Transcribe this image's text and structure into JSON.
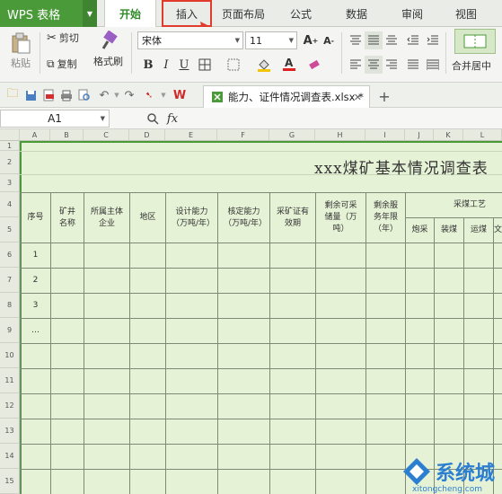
{
  "app": {
    "name": "WPS 表格"
  },
  "tabs": [
    "开始",
    "插入",
    "页面布局",
    "公式",
    "数据",
    "审阅",
    "视图"
  ],
  "ribbon": {
    "paste": "粘贴",
    "cut": "剪切",
    "copy": "复制",
    "format_painter": "格式刷",
    "font_name": "宋体",
    "font_size": "11",
    "merge": "合并居中"
  },
  "doc_tab": {
    "label": "能力、证件情况调查表.xlsx *"
  },
  "formula_bar": {
    "name_box": "A1",
    "fx": "fx"
  },
  "sheet": {
    "columns": [
      "A",
      "B",
      "C",
      "D",
      "E",
      "F",
      "G",
      "H",
      "I",
      "J",
      "K",
      "L"
    ],
    "rows": [
      "1",
      "2",
      "3",
      "4",
      "5",
      "6",
      "7",
      "8",
      "9",
      "10",
      "11",
      "12",
      "13",
      "14",
      "15"
    ],
    "title": "xxx煤矿基本情况调查表",
    "headers": {
      "seq": "序号",
      "mine_name": "矿井名称",
      "owner": "所属主体企业",
      "region": "地区",
      "design_capacity": "设计能力（万吨/年）",
      "approved_capacity": "核定能力（万吨/年）",
      "mining_license": "采矿证有效期",
      "reserves": "剩余可采储量（万吨）",
      "service_years": "剩余服务年限（年）",
      "mining_group": "采煤工艺",
      "blast": "炮采",
      "pneumatic": "装煤",
      "continuous": "运煤",
      "extra": "文"
    },
    "seq_values": [
      "1",
      "2",
      "3",
      "…"
    ]
  },
  "watermark": {
    "text": "系统城",
    "url": "xitongcheng.com"
  },
  "colors": {
    "accent": "#4b9a3a",
    "highlight": "#e03b2c",
    "cell_bg": "#e6f2d6"
  }
}
